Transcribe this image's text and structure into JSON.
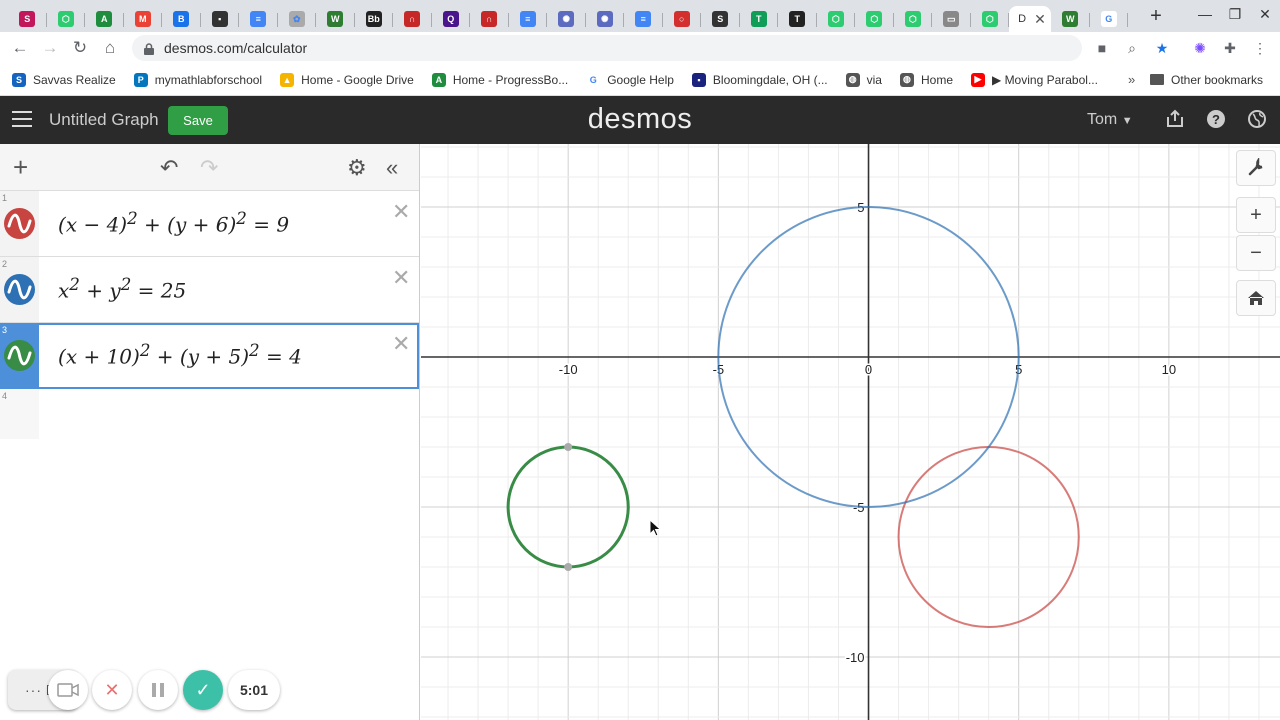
{
  "browser": {
    "tabs": [
      {
        "icon": "savvas-icon",
        "color": "#c2185b",
        "glyph": "S"
      },
      {
        "icon": "green-hex-icon",
        "color": "#2ecc71",
        "glyph": "⬡"
      },
      {
        "icon": "progressbook-icon",
        "color": "#1e8e3e",
        "glyph": "A"
      },
      {
        "icon": "gmail-icon",
        "color": "#ea4335",
        "glyph": "M"
      },
      {
        "icon": "classroom-icon",
        "color": "#1a73e8",
        "glyph": "B"
      },
      {
        "icon": "contact-icon",
        "color": "#333333",
        "glyph": "▪"
      },
      {
        "icon": "docs-icon",
        "color": "#4285f4",
        "glyph": "≡"
      },
      {
        "icon": "flower-icon",
        "color": "#aaaaaa",
        "glyph": "✿"
      },
      {
        "icon": "green-square-icon",
        "color": "#2e7d32",
        "glyph": "W"
      },
      {
        "icon": "blackboard-icon",
        "color": "#222222",
        "glyph": "Bb"
      },
      {
        "icon": "pearson-icon",
        "color": "#c62828",
        "glyph": "∩"
      },
      {
        "icon": "quizlet-icon",
        "color": "#4a148c",
        "glyph": "Q"
      },
      {
        "icon": "pearson-icon",
        "color": "#c62828",
        "glyph": "∩"
      },
      {
        "icon": "docs-icon",
        "color": "#4285f4",
        "glyph": "≡"
      },
      {
        "icon": "gear-flower-icon",
        "color": "#5c6bc0",
        "glyph": "✺"
      },
      {
        "icon": "gear-flower-icon",
        "color": "#5c6bc0",
        "glyph": "✺"
      },
      {
        "icon": "docs-icon",
        "color": "#4285f4",
        "glyph": "≡"
      },
      {
        "icon": "circle-icon",
        "color": "#d32f2f",
        "glyph": "○"
      },
      {
        "icon": "scribd-icon",
        "color": "#333333",
        "glyph": "S"
      },
      {
        "icon": "sheets-icon",
        "color": "#0f9d58",
        "glyph": "T"
      },
      {
        "icon": "nyt-icon",
        "color": "#222222",
        "glyph": "T"
      },
      {
        "icon": "green-hex-icon",
        "color": "#2ecc71",
        "glyph": "⬡"
      },
      {
        "icon": "green-hex-icon",
        "color": "#2ecc71",
        "glyph": "⬡"
      },
      {
        "icon": "green-hex-icon",
        "color": "#2ecc71",
        "glyph": "⬡"
      },
      {
        "icon": "keyboard-icon",
        "color": "#888888",
        "glyph": "▭"
      },
      {
        "icon": "green-hex-icon",
        "color": "#2ecc71",
        "glyph": "⬡"
      }
    ],
    "active_tab_label": "D",
    "after_tabs": [
      {
        "icon": "green-square-icon",
        "color": "#2e7d32",
        "glyph": "W"
      },
      {
        "icon": "google-icon",
        "color": "#ffffff",
        "glyph": "G"
      }
    ],
    "url": "desmos.com/calculator",
    "bookmarks": [
      {
        "label": "Savvas Realize",
        "color": "#1565c0",
        "glyph": "S"
      },
      {
        "label": "mymathlabforschool",
        "color": "#0277bd",
        "glyph": "P"
      },
      {
        "label": "Home - Google Drive",
        "color": "#f4b400",
        "glyph": "▲"
      },
      {
        "label": "Home - ProgressBo...",
        "color": "#1e8e3e",
        "glyph": "A"
      },
      {
        "label": "Google Help",
        "color": "#ffffff",
        "glyph": "G"
      },
      {
        "label": "Bloomingdale, OH (...",
        "color": "#1a237e",
        "glyph": "▪"
      },
      {
        "label": "via",
        "color": "#555555",
        "glyph": "◍"
      },
      {
        "label": "Home",
        "color": "#555555",
        "glyph": "◍"
      },
      {
        "label": "▶ Moving Parabol...",
        "color": "#ff0000",
        "glyph": "▶"
      }
    ],
    "other_bookmarks": "Other bookmarks"
  },
  "app": {
    "title": "Untitled Graph",
    "save_label": "Save",
    "logo": "desmos",
    "user": "Tom"
  },
  "expressions": [
    {
      "num": "1",
      "html": "(<i>x</i> − 4)<sup>2</sup> + (<i>y</i> + 6)<sup>2</sup> = 9",
      "color": "#c74440",
      "active": false
    },
    {
      "num": "2",
      "html": "<i>x</i><sup>2</sup> + <i>y</i><sup>2</sup> = 25",
      "color": "#2d70b3",
      "active": false
    },
    {
      "num": "3",
      "html": "(<i>x</i> + 10)<sup>2</sup> + (<i>y</i> + 5)<sup>2</sup> = 4",
      "color": "#388c46",
      "active": true
    }
  ],
  "empty_row_num": "4",
  "chart_data": {
    "type": "scatter",
    "title": "",
    "xlim": [
      -14.9,
      13.7
    ],
    "ylim": [
      -12.1,
      7.1
    ],
    "x_ticks": [
      -10,
      -5,
      0,
      5,
      10
    ],
    "y_ticks": [
      5,
      -5,
      -10
    ],
    "x_tick_labels": [
      "-10",
      "-5",
      "0",
      "5",
      "10"
    ],
    "y_tick_labels": [
      "5",
      "-5",
      "-10"
    ],
    "grid": true,
    "circles": [
      {
        "h": 4,
        "k": -6,
        "r": 3,
        "color": "#c74440"
      },
      {
        "h": 0,
        "k": 0,
        "r": 5,
        "color": "#2d70b3"
      },
      {
        "h": -10,
        "k": -5,
        "r": 2,
        "color": "#388c46"
      }
    ],
    "highlight_points": [
      [
        -10,
        -3
      ],
      [
        -10,
        -7
      ]
    ]
  },
  "recorder": {
    "timer": "5:01"
  }
}
